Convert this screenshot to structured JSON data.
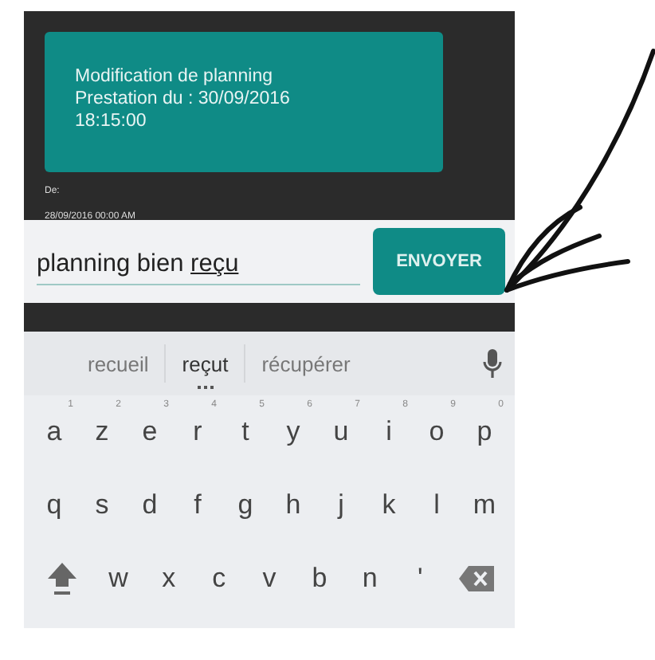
{
  "message": {
    "lines": [
      "Modification de planning",
      "Prestation du : 30/09/2016",
      "18:15:00"
    ],
    "from_label": "De:",
    "date": "28/09/2016 00:00 AM"
  },
  "compose": {
    "value": "planning bien",
    "composing": "reçu",
    "send_button": "ENVOYER"
  },
  "keyboard": {
    "suggestions": [
      {
        "text": "recueil",
        "selected": false
      },
      {
        "text": "reçut",
        "selected": true
      },
      {
        "text": "récupérer",
        "selected": false
      }
    ],
    "rows": [
      [
        {
          "kind": "letter",
          "label": "a",
          "hint": "1"
        },
        {
          "kind": "letter",
          "label": "z",
          "hint": "2"
        },
        {
          "kind": "letter",
          "label": "e",
          "hint": "3"
        },
        {
          "kind": "letter",
          "label": "r",
          "hint": "4"
        },
        {
          "kind": "letter",
          "label": "t",
          "hint": "5"
        },
        {
          "kind": "letter",
          "label": "y",
          "hint": "6"
        },
        {
          "kind": "letter",
          "label": "u",
          "hint": "7"
        },
        {
          "kind": "letter",
          "label": "i",
          "hint": "8"
        },
        {
          "kind": "letter",
          "label": "o",
          "hint": "9"
        },
        {
          "kind": "letter",
          "label": "p",
          "hint": "0"
        }
      ],
      [
        {
          "kind": "letter",
          "label": "q"
        },
        {
          "kind": "letter",
          "label": "s"
        },
        {
          "kind": "letter",
          "label": "d"
        },
        {
          "kind": "letter",
          "label": "f"
        },
        {
          "kind": "letter",
          "label": "g"
        },
        {
          "kind": "letter",
          "label": "h"
        },
        {
          "kind": "letter",
          "label": "j"
        },
        {
          "kind": "letter",
          "label": "k"
        },
        {
          "kind": "letter",
          "label": "l"
        },
        {
          "kind": "letter",
          "label": "m"
        }
      ],
      [
        {
          "kind": "shift"
        },
        {
          "kind": "letter",
          "label": "w"
        },
        {
          "kind": "letter",
          "label": "x"
        },
        {
          "kind": "letter",
          "label": "c"
        },
        {
          "kind": "letter",
          "label": "v"
        },
        {
          "kind": "letter",
          "label": "b"
        },
        {
          "kind": "letter",
          "label": "n"
        },
        {
          "kind": "letter",
          "label": "'"
        },
        {
          "kind": "backspace"
        }
      ]
    ]
  }
}
